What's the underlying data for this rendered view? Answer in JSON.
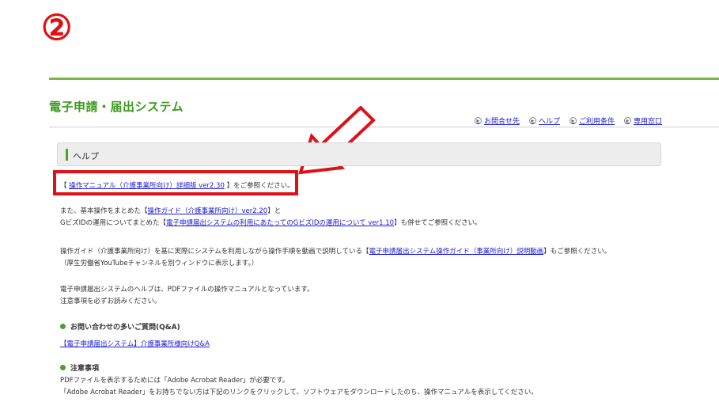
{
  "step_marker": "②",
  "system_title": "電子申請・届出システム",
  "header_links": [
    {
      "label": "お問合せ先"
    },
    {
      "label": "ヘルプ"
    },
    {
      "label": "ご利用条件"
    },
    {
      "label": "専用窓口"
    }
  ],
  "help_heading": "ヘルプ",
  "line1": {
    "pre": "【",
    "link": "操作マニュアル（介護事業所向け）詳細版 ver2.30",
    "post": "】をご参照ください。"
  },
  "line2": {
    "pre": "また、基本操作をまとめた【",
    "link": "操作ガイド（介護事業所向け）ver2.20",
    "post": "】と"
  },
  "line3": {
    "pre": "GビズIDの運用についてまとめた【",
    "link": "電子申請届出システムの利用にあたってのGビズIDの運用について ver1.10",
    "post": "】も併せてご参照ください。"
  },
  "line4": {
    "pre": "操作ガイド（介護事業所向け）を基に実際にシステムを利用しながら操作手順を動画で説明している【",
    "link": "電子申請届出システム操作ガイド（事業所向け）説明動画",
    "post": "】もご参照ください。"
  },
  "line5": "（厚生労働省YouTubeチャンネルを別ウィンドウに表示します。）",
  "line6": "電子申請届出システムのヘルプは、PDFファイルの操作マニュアルとなっています。",
  "line7": "注意事項を必ずお読みください。",
  "faq_heading": "お問い合わせの多いご質問(Q&A)",
  "faq_link": "【電子申請届出システム】介護事業所様向けQ&A",
  "notes_heading": "注意事項",
  "note1": "PDFファイルを表示するためには「Adobe Acrobat Reader」が必要です。",
  "note2": "「Adobe Acrobat Reader」をお持ちでない方は下記のリンクをクリックして、ソフトウェアをダウンロードしたのち、操作マニュアルを表示してください。",
  "colors": {
    "accent_green": "#3b9a1f",
    "highlight_red": "#e0101a",
    "link_blue": "#1a1adb"
  },
  "icons": {
    "header_link": "circle-arrow-icon",
    "annotation": "red-arrow-icon",
    "section_bullet": "green-dot-icon"
  }
}
